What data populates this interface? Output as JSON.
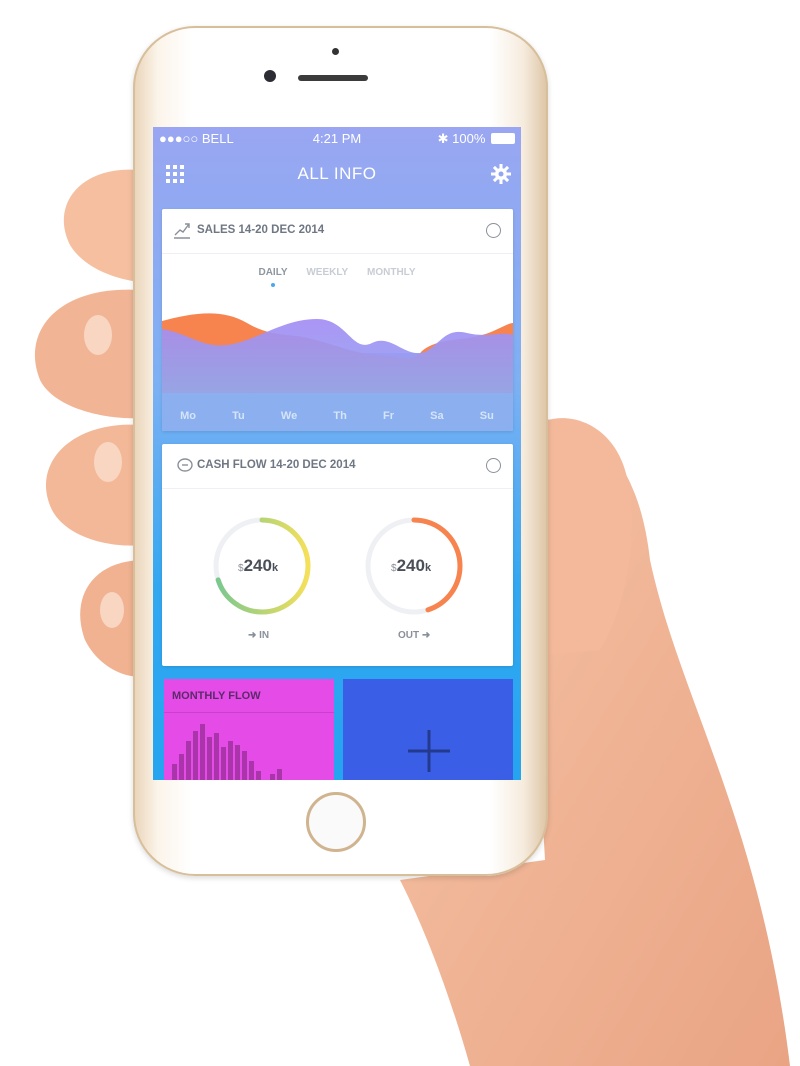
{
  "status_bar": {
    "carrier": "●●●○○ BELL",
    "time": "4:21 PM",
    "battery": "100%"
  },
  "navbar": {
    "title": "ALL INFO",
    "left_icon": "grid-icon",
    "right_icon": "gear-icon"
  },
  "sales_card": {
    "title": "SALES 14-20 DEC 2014",
    "tabs": [
      "DAILY",
      "WEEKLY",
      "MONTHLY"
    ],
    "active_tab": "DAILY",
    "days": [
      "Mo",
      "Tu",
      "We",
      "Th",
      "Fr",
      "Sa",
      "Su"
    ]
  },
  "cashflow_card": {
    "title": "CASH FLOW 14-20 DEC 2014",
    "in": {
      "currency": "$",
      "amount": "240",
      "unit": "k",
      "caption": "➜ IN",
      "fraction": 0.7
    },
    "out": {
      "currency": "$",
      "amount": "240",
      "unit": "k",
      "caption": "OUT ➜",
      "fraction": 0.45
    }
  },
  "monthly_card": {
    "title": "MONTHLY FLOW",
    "color": "#e54be6"
  },
  "add_tile": {
    "icon": "plus-icon",
    "color": "#3a5ee6"
  },
  "colors": {
    "accent_orange": "#f7834f",
    "accent_purple": "#a48cf4",
    "ring_green": "#78c88f",
    "ring_yellow": "#f5e05a"
  }
}
